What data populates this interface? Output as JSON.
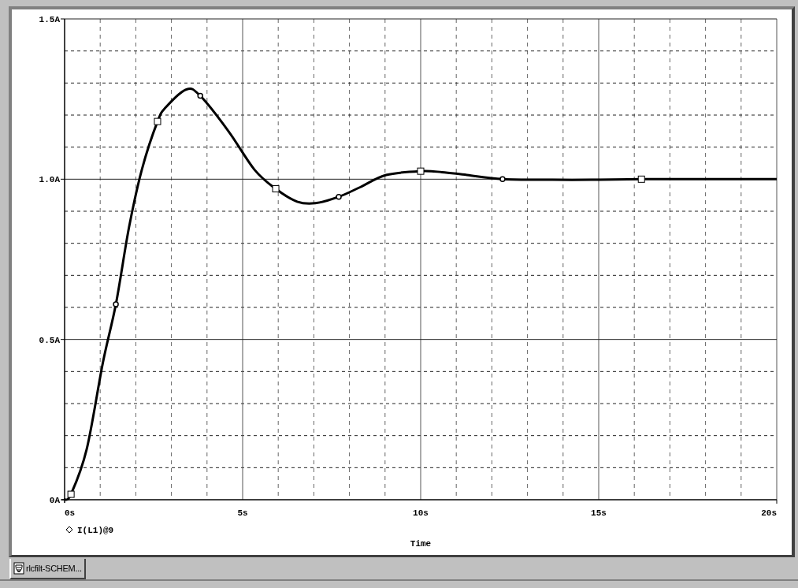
{
  "plot": {
    "chart_data": {
      "type": "line",
      "xlabel": "Time",
      "grid": true,
      "xlim": [
        0,
        20
      ],
      "ylim": [
        0,
        1.5
      ],
      "xticks": [
        {
          "value": 0,
          "label": "0s"
        },
        {
          "value": 5,
          "label": "5s"
        },
        {
          "value": 10,
          "label": "10s"
        },
        {
          "value": 15,
          "label": "15s"
        },
        {
          "value": 20,
          "label": "20s"
        }
      ],
      "yticks": [
        {
          "value": 0,
          "label": "0A"
        },
        {
          "value": 0.5,
          "label": "0.5A"
        },
        {
          "value": 1,
          "label": "1.0A"
        },
        {
          "value": 1.5,
          "label": "1.5A"
        }
      ],
      "x": [
        0,
        0.18,
        0.62,
        1.08,
        1.44,
        1.81,
        2.17,
        2.61,
        2.85,
        3.42,
        3.81,
        4.6,
        5.33,
        5.93,
        6.53,
        7.04,
        7.7,
        8.3,
        9.03,
        10.0,
        10.6,
        11.3,
        12.3,
        13.7,
        14.8,
        16.2,
        18.1,
        20
      ],
      "series": [
        {
          "name": "I(L1)@9",
          "color": "#000000",
          "values": [
            0,
            0.017,
            0.157,
            0.43,
            0.61,
            0.85,
            1.03,
            1.18,
            1.225,
            1.28,
            1.26,
            1.15,
            1.03,
            0.97,
            0.93,
            0.925,
            0.945,
            0.975,
            1.013,
            1.025,
            1.022,
            1.013,
            1.0,
            0.998,
            0.998,
            1.0,
            1.0,
            1.0
          ]
        }
      ]
    }
  },
  "tabs": [
    {
      "label": "rlcfilt-SCHEM...",
      "selected": true
    }
  ]
}
